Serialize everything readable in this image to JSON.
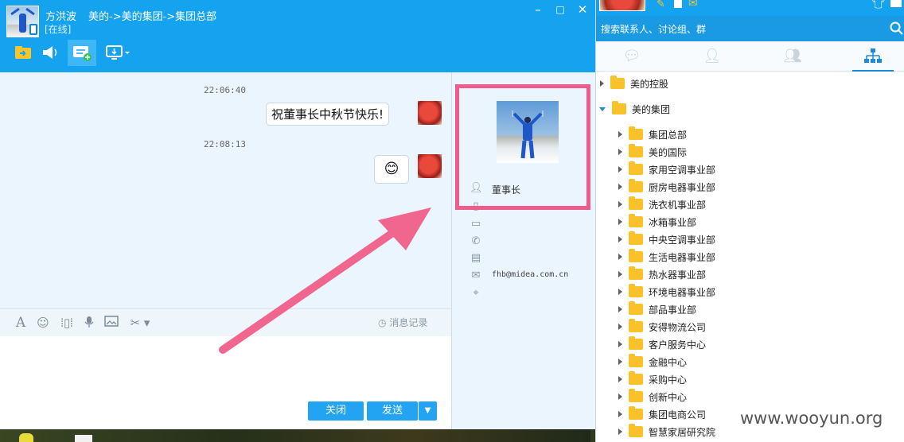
{
  "chat_header": {
    "contact_name": "方洪波",
    "org_path": "美的->美的集团->集团总部",
    "status": "[在线]"
  },
  "window_controls": {
    "minimize": "–",
    "maximize": "□",
    "close": "✕"
  },
  "toolbar": [
    "file-transfer-icon",
    "speaker-icon",
    "message-add-icon",
    "screen-share-icon"
  ],
  "messages": [
    {
      "time": "22:06:40",
      "text": "祝董事长中秋节快乐!"
    },
    {
      "time": "22:08:13",
      "text": "😊"
    }
  ],
  "input_toolbar": {
    "icons": [
      "font-icon",
      "emoji-icon",
      "shake-icon",
      "voice-icon",
      "image-icon",
      "screenshot-icon"
    ],
    "history_label": "消息记录"
  },
  "buttons": {
    "close": "关闭",
    "send": "发送"
  },
  "profile": {
    "title": "董事长",
    "email": "fhb@midea.com.cn"
  },
  "contacts": {
    "search_placeholder": "搜索联系人、讨论组、群",
    "tabs": [
      "recent-chat-icon",
      "contact-icon",
      "group-icon",
      "org-tree-icon"
    ],
    "top_level": [
      {
        "label": "美的控股",
        "expanded": false
      },
      {
        "label": "美的集团",
        "expanded": true
      }
    ],
    "departments": [
      "集团总部",
      "美的国际",
      "家用空调事业部",
      "厨房电器事业部",
      "洗衣机事业部",
      "冰箱事业部",
      "中央空调事业部",
      "生活电器事业部",
      "热水器事业部",
      "环境电器事业部",
      "部品事业部",
      "安得物流公司",
      "客户服务中心",
      "金融中心",
      "采购中心",
      "创新中心",
      "集团电商公司",
      "智慧家居研究院"
    ]
  },
  "watermark": "www.wooyun.org",
  "colors": {
    "header_blue": "#15a3f0",
    "annotation_pink": "#ee5b8c",
    "folder_yellow": "#f9c12a",
    "button_blue": "#22a4f3"
  }
}
